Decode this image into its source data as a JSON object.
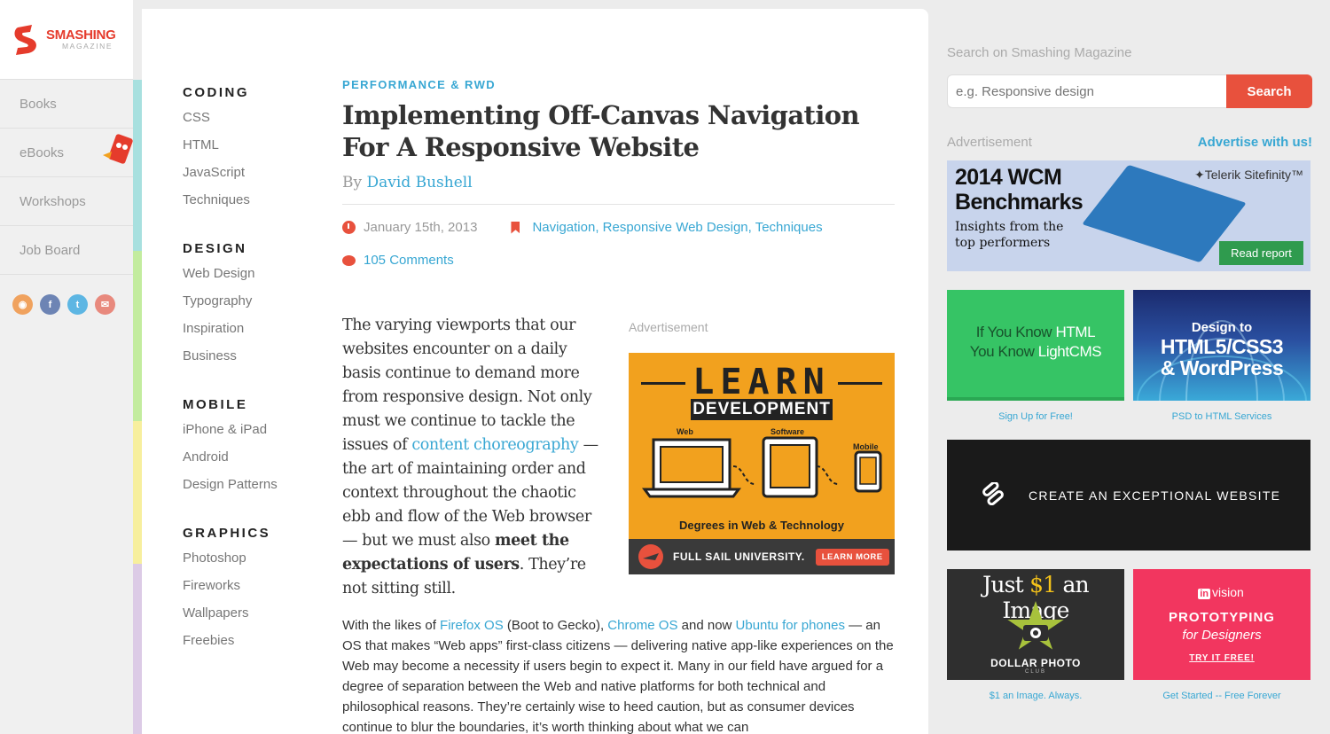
{
  "logo": {
    "word1": "SMASHING",
    "word2": "MAGAZINE"
  },
  "sidebar": {
    "items": [
      {
        "label": "Books"
      },
      {
        "label": "eBooks"
      },
      {
        "label": "Workshops"
      },
      {
        "label": "Job Board"
      }
    ],
    "social": [
      {
        "icon": "rss-icon",
        "glyph": "◉",
        "color": "#f0a25e"
      },
      {
        "icon": "facebook-icon",
        "glyph": "f",
        "color": "#6d84b4"
      },
      {
        "icon": "twitter-icon",
        "glyph": "t",
        "color": "#5db6e3"
      },
      {
        "icon": "email-icon",
        "glyph": "✉",
        "color": "#e8897d"
      }
    ]
  },
  "stripe_colors": [
    "#a8e0df",
    "#c3ec9f",
    "#f7ef9e",
    "#dccbe6"
  ],
  "categories": [
    {
      "heading": "CODING",
      "links": [
        "CSS",
        "HTML",
        "JavaScript",
        "Techniques"
      ]
    },
    {
      "heading": "DESIGN",
      "links": [
        "Web Design",
        "Typography",
        "Inspiration",
        "Business"
      ]
    },
    {
      "heading": "MOBILE",
      "links": [
        "iPhone & iPad",
        "Android",
        "Design Patterns"
      ]
    },
    {
      "heading": "GRAPHICS",
      "links": [
        "Photoshop",
        "Fireworks",
        "Wallpapers",
        "Freebies"
      ]
    }
  ],
  "article": {
    "kicker": "Performance & RWD",
    "title": "Implementing Off-Canvas Navigation For A Responsive Website",
    "by": "By",
    "author": "David Bushell",
    "date": "January 15th, 2013",
    "tags": "Navigation, Responsive Web Design, Techniques",
    "comments": "105 Comments",
    "intro_1": "The varying viewports that our websites encounter on a daily basis continue to demand more from responsive design. Not only must we continue to tackle the issues of ",
    "intro_link": "content choreography",
    "intro_2": " — the art of maintaining order and context throughout the chaotic ebb and flow of the Web browser — but we must also ",
    "intro_bold": "meet the expectations of users",
    "intro_3": ". They’re not sitting still.",
    "para_1": "With the likes of ",
    "link_firefox": "Firefox OS",
    "para_2": " (Boot to Gecko), ",
    "link_chrome": "Chrome OS",
    "para_3": " and now ",
    "link_ubuntu": "Ubuntu for phones",
    "para_4": " — an OS that makes “Web apps” first-class citizens — delivering native app-like experiences on the Web may become a necessity if users begin to expect it. Many in our field have argued for a degree of separation between the Web and native platforms for both technical and philosophical reasons. They’re certainly wise to heed caution, but as consumer devices continue to blur the boundaries, it’s worth thinking about what we can"
  },
  "inline_ad": {
    "label": "Advertisement",
    "learn": "LEARN",
    "development": "DEVELOPMENT",
    "web": "Web",
    "software": "Software",
    "mobile": "Mobile",
    "degrees": "Degrees in Web & Technology",
    "university": "FULL SAIL UNIVERSITY.",
    "cta": "LEARN MORE"
  },
  "search": {
    "label": "Search on Smashing Magazine",
    "placeholder": "e.g. Responsive design",
    "button": "Search"
  },
  "ads": {
    "label": "Advertisement",
    "advertise": "Advertise with us!",
    "telerik": {
      "head1": "2014 WCM",
      "head2": "Benchmarks",
      "sub1": "Insights from the",
      "sub2": "top performers",
      "logo": "✦Telerik Sitefinity™",
      "button": "Read report"
    },
    "lightcms": {
      "line1a": "If You Know ",
      "line1b": "HTML",
      "line2a": "You Know ",
      "line2b": "LightCMS",
      "caption": "Sign Up for Free!"
    },
    "html5": {
      "line1": "Design to",
      "line2": "HTML5/CSS3",
      "line3": "& WordPress",
      "caption": "PSD to HTML Services"
    },
    "squarespace": {
      "text": "CREATE AN EXCEPTIONAL WEBSITE"
    },
    "dollar": {
      "head_a": "Just ",
      "head_b": "$1",
      "head_c": " an Image",
      "name": "DOLLAR PHOTO",
      "club": "CLUB",
      "caption": "$1 an Image. Always."
    },
    "invision": {
      "logo_a": "in",
      "logo_b": "vision",
      "line1": "PROTOTYPING",
      "line2": "for Designers",
      "cta": "TRY IT FREE!",
      "caption": "Get Started -- Free Forever"
    }
  }
}
